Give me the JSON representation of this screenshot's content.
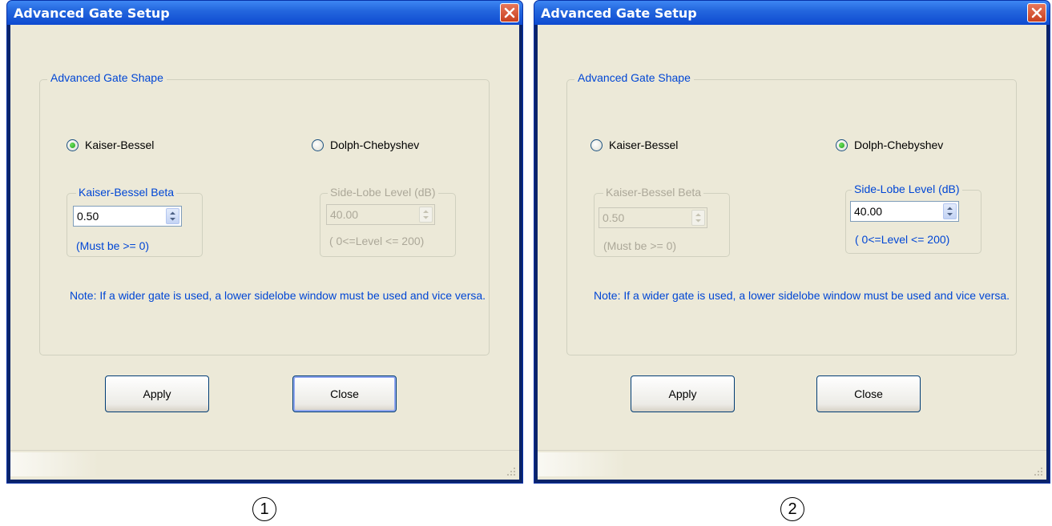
{
  "dialogs": [
    {
      "title": "Advanced Gate Setup",
      "group_label": "Advanced Gate Shape",
      "radio_kaiser": "Kaiser-Bessel",
      "radio_dolph": "Dolph-Chebyshev",
      "selected": "kaiser",
      "kaiser_group": {
        "label": "Kaiser-Bessel Beta",
        "value": "0.50",
        "hint": "(Must be >= 0)",
        "enabled": true
      },
      "dolph_group": {
        "label": "Side-Lobe Level (dB)",
        "value": "40.00",
        "hint": "( 0<=Level <= 200)",
        "enabled": false
      },
      "note": "Note: If a wider gate is used, a lower sidelobe window must be used and vice versa.",
      "apply_label": "Apply",
      "close_label": "Close",
      "default_button": "close"
    },
    {
      "title": "Advanced Gate Setup",
      "group_label": "Advanced Gate Shape",
      "radio_kaiser": "Kaiser-Bessel",
      "radio_dolph": "Dolph-Chebyshev",
      "selected": "dolph",
      "kaiser_group": {
        "label": "Kaiser-Bessel Beta",
        "value": "0.50",
        "hint": "(Must be >= 0)",
        "enabled": false
      },
      "dolph_group": {
        "label": "Side-Lobe Level (dB)",
        "value": "40.00",
        "hint": "( 0<=Level <= 200)",
        "enabled": true
      },
      "note": "Note: If a wider gate is used, a lower sidelobe window must be used and vice versa.",
      "apply_label": "Apply",
      "close_label": "Close",
      "default_button": "none"
    }
  ],
  "callouts": [
    "1",
    "2"
  ],
  "colors": {
    "label_blue": "#0046d5",
    "disabled_gray": "#aca899",
    "dialog_bg": "#ece9d8",
    "title_blue": "#0e4ad0"
  },
  "icons": [
    "close-icon",
    "spin-arrows-icon",
    "resize-grip-icon"
  ]
}
